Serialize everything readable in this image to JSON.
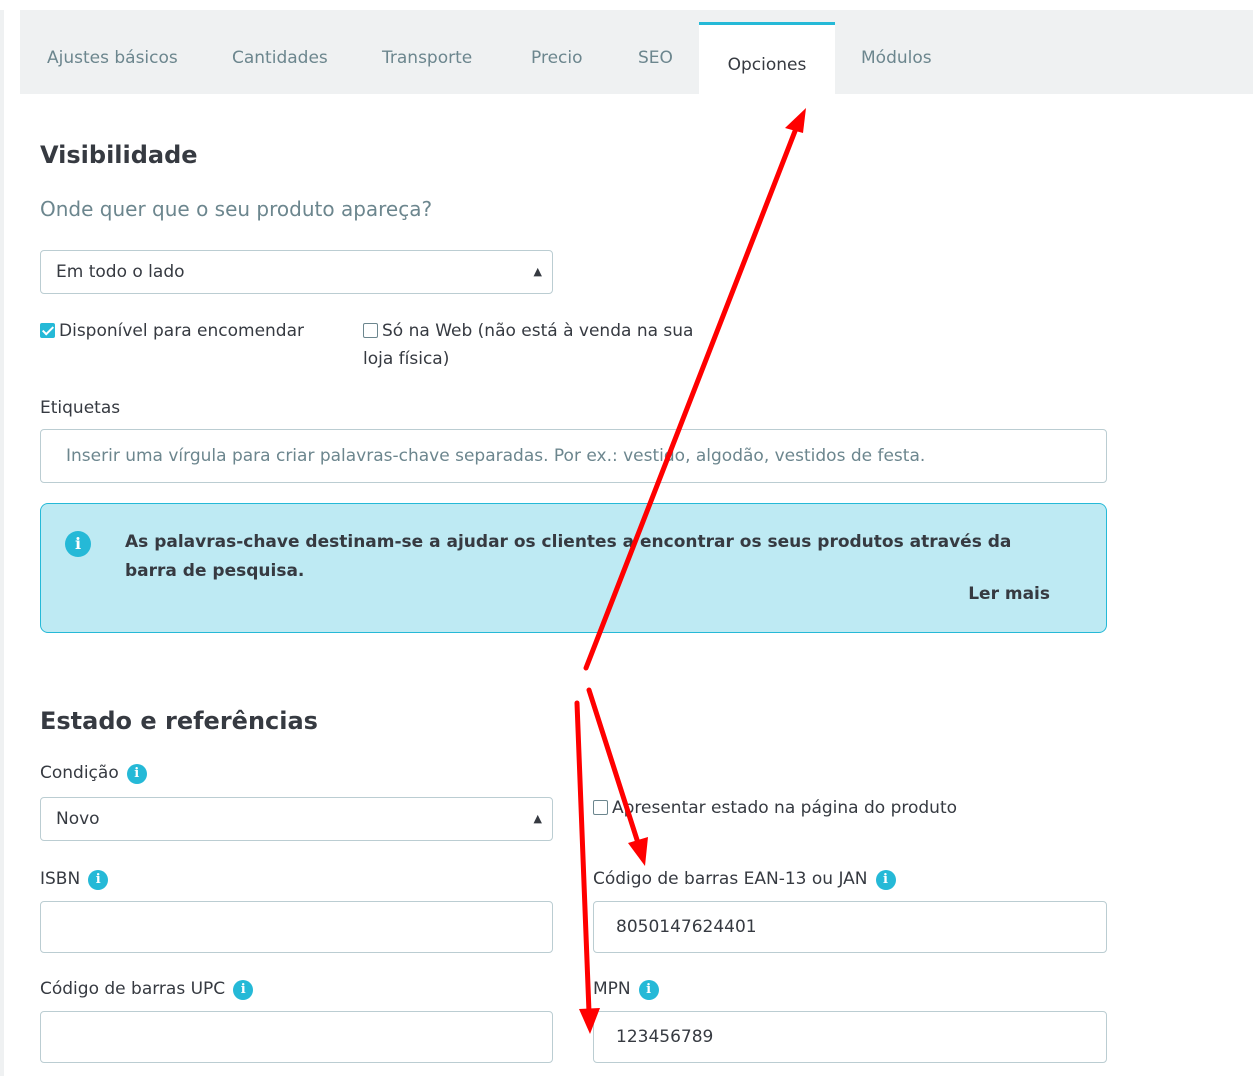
{
  "tabs": [
    {
      "label": "Ajustes básicos"
    },
    {
      "label": "Cantidades"
    },
    {
      "label": "Transporte"
    },
    {
      "label": "Precio"
    },
    {
      "label": "SEO"
    },
    {
      "label": "Opciones"
    },
    {
      "label": "Módulos"
    }
  ],
  "visibility": {
    "title": "Visibilidade",
    "subtitle": "Onde quer que o seu produto apareça?",
    "select_value": "Em todo o lado",
    "available_label": "Disponível para encomendar",
    "web_only_label_1": "Só na Web (não está à venda na sua",
    "web_only_label_2": "loja física)"
  },
  "tags": {
    "label": "Etiquetas",
    "placeholder": "Inserir uma vírgula para criar palavras-chave separadas. Por ex.: vestido, algodão, vestidos de festa."
  },
  "alert": {
    "message": "As palavras-chave destinam-se a ajudar os clientes a encontrar os seus produtos através da barra de pesquisa.",
    "link": "Ler mais"
  },
  "condition": {
    "title": "Estado e referências",
    "label": "Condição",
    "select_value": "Novo",
    "show_label": "Apresentar estado na página do produto"
  },
  "refs": {
    "isbn_label": "ISBN",
    "isbn_value": "",
    "ean_label": "Código de barras EAN-13 ou JAN",
    "ean_value": "8050147624401",
    "upc_label": "Código de barras UPC",
    "upc_value": "",
    "mpn_label": "MPN",
    "mpn_value": "123456789"
  },
  "colors": {
    "accent": "#25b9d7",
    "annotation_arrow": "#ff0000"
  }
}
